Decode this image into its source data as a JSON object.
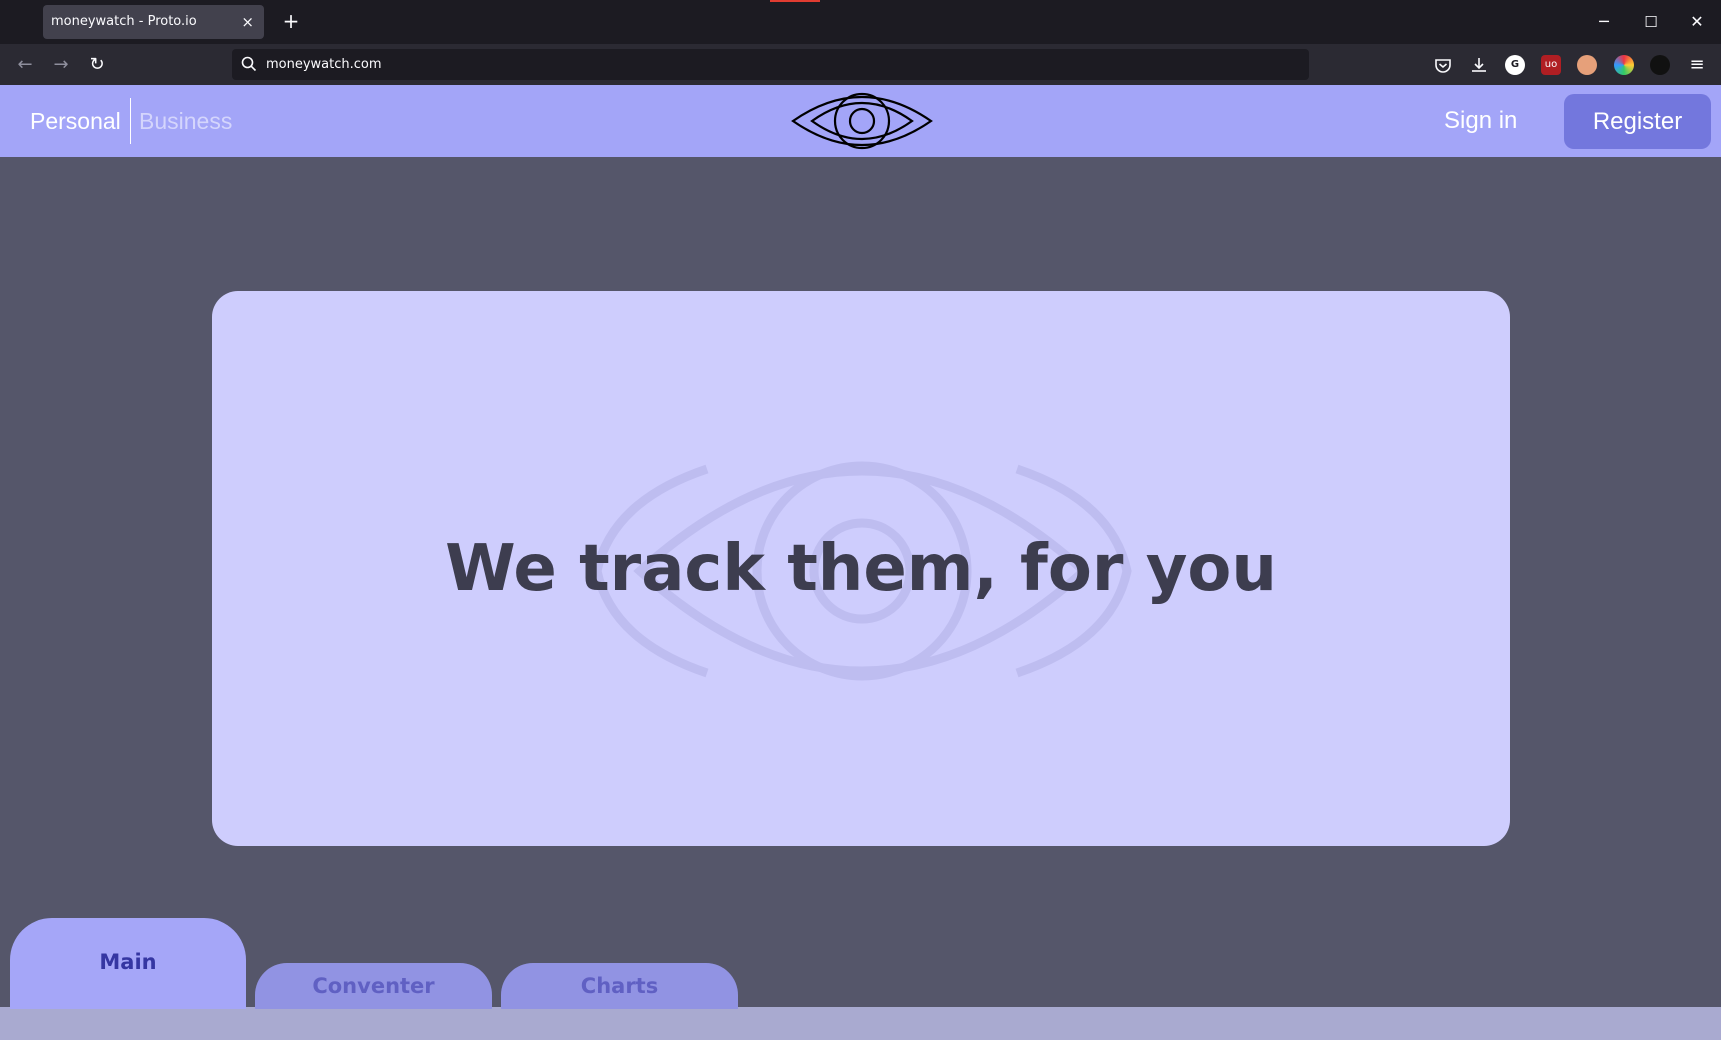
{
  "browser": {
    "tab_title": "moneywatch - Proto.io",
    "tab_close": "×",
    "new_tab": "+",
    "url": "moneywatch.com",
    "window": {
      "minimize": "─",
      "maximize": "☐",
      "close": "✕"
    }
  },
  "header": {
    "personal": "Personal",
    "business": "Business",
    "sign_in": "Sign in",
    "register": "Register"
  },
  "hero": {
    "headline": "We track them, for you"
  },
  "tabs": [
    {
      "label": "Main",
      "active": true
    },
    {
      "label": "Conventer",
      "active": false
    },
    {
      "label": "Charts",
      "active": false
    }
  ],
  "colors": {
    "header_bg": "#a3a5f8",
    "page_bg": "#55566a",
    "card_bg": "#cecdfd",
    "register_bg": "#7377dd"
  },
  "icons": [
    "back-icon",
    "forward-icon",
    "reload-icon",
    "search-icon",
    "pocket-icon",
    "download-icon",
    "extension-icon",
    "menu-icon",
    "eye-logo-icon"
  ]
}
